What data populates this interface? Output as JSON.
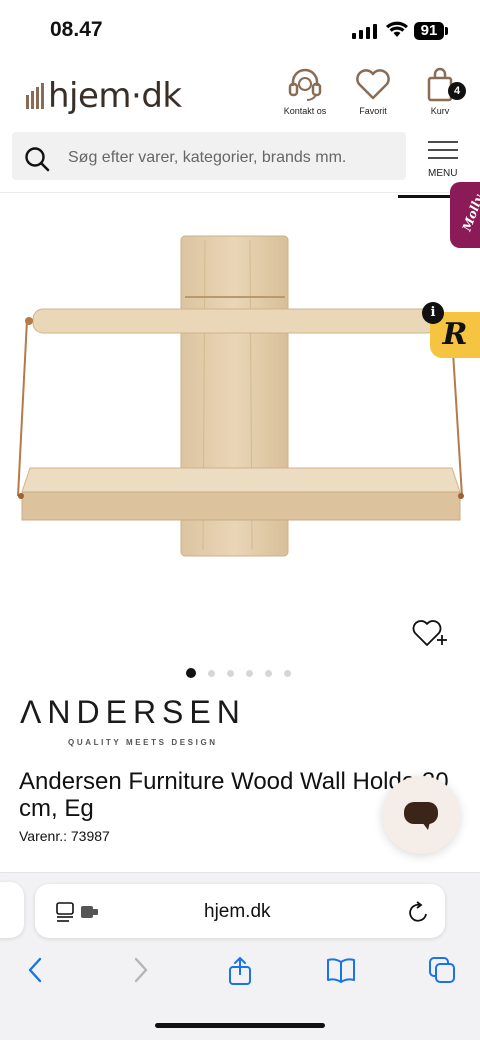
{
  "status_bar": {
    "time": "08.47",
    "battery": "91"
  },
  "header": {
    "logo": "hjem·dk",
    "contact_label": "Kontakt os",
    "favorite_label": "Favorit",
    "cart_label": "Kurv",
    "cart_count": "4"
  },
  "search": {
    "placeholder": "Søg efter varer, kategorier, brands mm."
  },
  "menu": {
    "label": "MENU"
  },
  "side_tabs": {
    "molly": "Molly",
    "r_badge": "R",
    "info": "i"
  },
  "gallery": {
    "dots": 6,
    "active_index": 0
  },
  "product": {
    "brand": "ΛNDERSEN",
    "brand_tagline": "QUALITY MEETS DESIGN",
    "title": "Andersen Furniture Wood Wall Holde 30 cm, Eg",
    "sku": "Varenr.: 73987"
  },
  "browser": {
    "url": "hjem.dk"
  },
  "colors": {
    "accent": "#8a1b56",
    "badge_yellow": "#f5c542",
    "logo_brown": "#8a6c54",
    "wood": "#e4cfae",
    "link_blue": "#1a73e8"
  }
}
